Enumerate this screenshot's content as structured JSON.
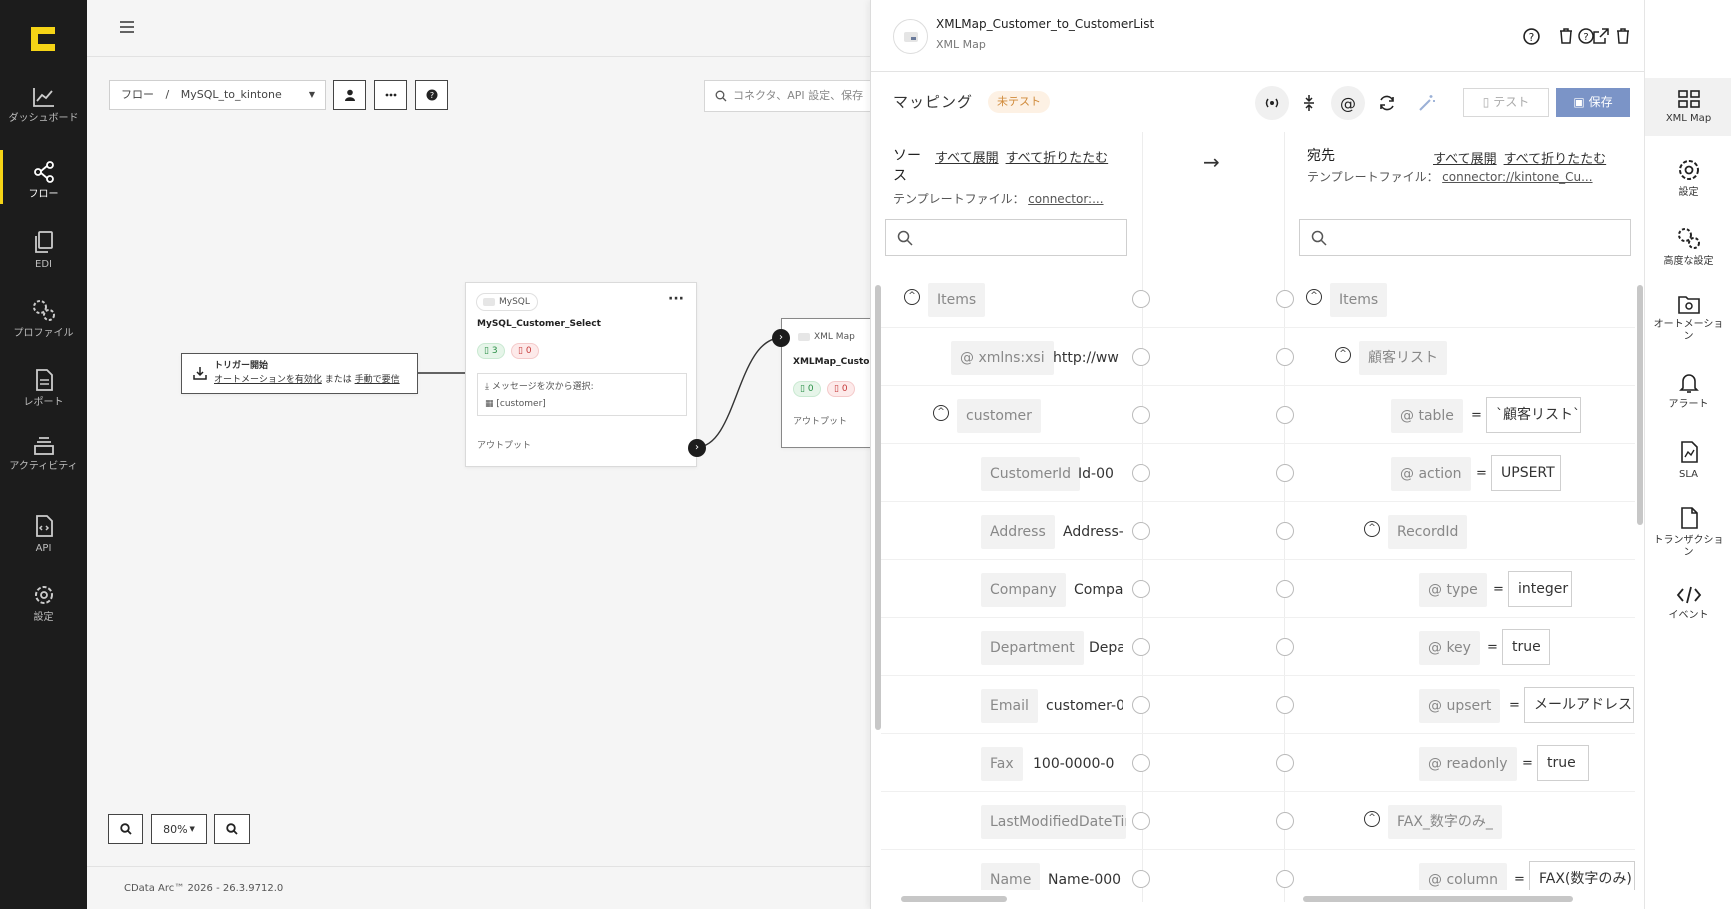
{
  "leftnav": {
    "items": [
      {
        "label": "ダッシュボード",
        "icon": "dashboard-icon"
      },
      {
        "label": "フロー",
        "icon": "flow-icon"
      },
      {
        "label": "EDI",
        "icon": "edi-icon"
      },
      {
        "label": "プロファイル",
        "icon": "profile-icon"
      },
      {
        "label": "レポート",
        "icon": "report-icon"
      },
      {
        "label": "アクティビティ",
        "icon": "activity-icon"
      },
      {
        "label": "API",
        "icon": "api-icon"
      },
      {
        "label": "設定",
        "icon": "settings-icon"
      }
    ]
  },
  "canvas": {
    "breadcrumb_root": "フロー",
    "breadcrumb_sep": "/",
    "breadcrumb_flow": "MySQL_to_kintone",
    "search_placeholder": "コネクタ、API 設定、保存",
    "trigger": {
      "title": "トリガー開始",
      "link1": "オートメーションを有効化",
      "middle": "または",
      "link2": "手動で要信"
    },
    "mysql_node": {
      "type": "MySQL",
      "title": "MySQL_Customer_Select",
      "success": "3",
      "error": "0",
      "msg_label": "メッセージを次から選択:",
      "msg_value": "[customer]",
      "output": "アウトプット"
    },
    "xml_node": {
      "type": "XML Map",
      "title": "XMLMap_Custom",
      "success": "0",
      "error": "0",
      "output": "アウトプット"
    },
    "zoom_level": "80%",
    "footer": "CData Arc™ 2026 - 26.3.9712.0"
  },
  "panel": {
    "title": "XMLMap_Customer_to_CustomerList",
    "subtitle": "XML Map",
    "mapping_label": "マッピング",
    "status_badge": "未テスト",
    "test_label": "テスト",
    "save_label": "保存",
    "source": {
      "label": "ソース",
      "expand_all": "すべて展開",
      "collapse_all": "すべて折りたたむ",
      "template_label": "テンプレートファイル：",
      "template_file": "connector:..."
    },
    "dest": {
      "label": "宛先",
      "expand_all": "すべて展開",
      "collapse_all": "すべて折りたたむ",
      "template_label": "テンプレートファイル：",
      "template_file": "connector://kintone_Cu..."
    },
    "arrow": "→",
    "source_rows": [
      {
        "name": "Items",
        "value": ""
      },
      {
        "name": "xmlns:xsi",
        "value": "http://ww"
      },
      {
        "name": "customer",
        "value": ""
      },
      {
        "name": "CustomerId",
        "value": "Id-00"
      },
      {
        "name": "Address",
        "value": "Address-"
      },
      {
        "name": "Company",
        "value": "Compa"
      },
      {
        "name": "Department",
        "value": "Depa"
      },
      {
        "name": "Email",
        "value": "customer-0"
      },
      {
        "name": "Fax",
        "value": "100-0000-0"
      },
      {
        "name": "LastModifiedDateTim",
        "value": ""
      },
      {
        "name": "Name",
        "value": "Name-000"
      }
    ],
    "dest_rows": [
      {
        "name": "Items",
        "value": ""
      },
      {
        "name": "顧客リスト",
        "value": ""
      },
      {
        "name": "table",
        "value": "`顧客リスト`"
      },
      {
        "name": "action",
        "value": "UPSERT"
      },
      {
        "name": "RecordId",
        "value": ""
      },
      {
        "name": "type",
        "value": "integer"
      },
      {
        "name": "key",
        "value": "true"
      },
      {
        "name": "upsert",
        "value": "メールアドレス"
      },
      {
        "name": "readonly",
        "value": "true"
      },
      {
        "name": "FAX_数字のみ_",
        "value": ""
      },
      {
        "name": "column",
        "value": "FAX(数字のみ)"
      }
    ],
    "attr_symbol": "@",
    "eq_symbol": "="
  },
  "rail": {
    "items": [
      {
        "label": "XML Map",
        "icon": "xml-map-icon"
      },
      {
        "label": "設定",
        "icon": "settings-icon"
      },
      {
        "label": "高度な設定",
        "icon": "advanced-settings-icon"
      },
      {
        "label": "オートメーション",
        "icon": "automation-icon"
      },
      {
        "label": "アラート",
        "icon": "alert-bell-icon"
      },
      {
        "label": "SLA",
        "icon": "sla-icon"
      },
      {
        "label": "トランザクション",
        "icon": "transaction-icon"
      },
      {
        "label": "イベント",
        "icon": "event-code-icon"
      }
    ]
  },
  "colors": {
    "nav_bg": "#1c1c1c",
    "accent_yellow": "#f5d416",
    "save_blue": "#7b94c7",
    "badge_orange": "#d08a3a"
  }
}
